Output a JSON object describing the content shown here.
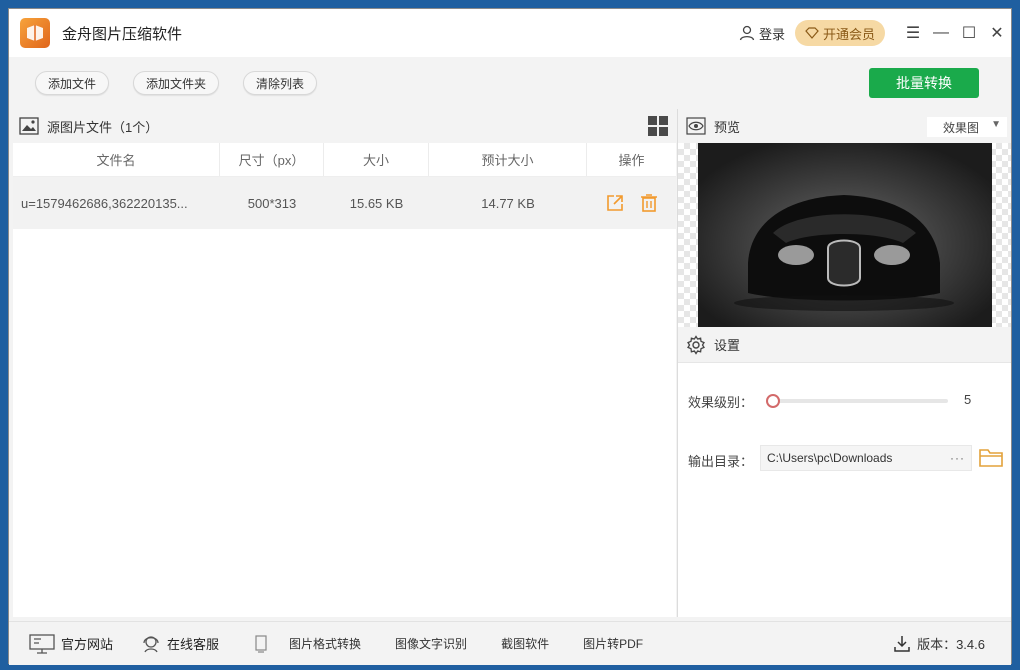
{
  "app": {
    "title": "金舟图片压缩软件"
  },
  "titlebar": {
    "login_label": "登录",
    "vip_label": "开通会员"
  },
  "toolbar": {
    "add_file_label": "添加文件",
    "add_folder_label": "添加文件夹",
    "clear_list_label": "清除列表",
    "batch_convert_label": "批量转换"
  },
  "source": {
    "header_label": "源图片文件（1个）",
    "columns": [
      "文件名",
      "尺寸（px）",
      "大小",
      "预计大小",
      "操作"
    ],
    "rows": [
      {
        "filename": "u=1579462686,362220135...",
        "dimensions": "500*313",
        "size": "15.65 KB",
        "estimated_size": "14.77 KB"
      }
    ]
  },
  "preview": {
    "label": "预览",
    "mode_selected": "效果图"
  },
  "settings": {
    "label": "设置",
    "effect_level_label": "效果级别：",
    "effect_level_value": "5",
    "output_dir_label": "输出目录：",
    "output_dir_value": "C:\\Users\\pc\\Downloads",
    "browse_label": "···"
  },
  "footer": {
    "official_site_label": "官方网站",
    "online_service_label": "在线客服",
    "links": [
      "图片格式转换",
      "图像文字识别",
      "截图软件",
      "图片转PDF"
    ],
    "version_label": "版本：3.4.6"
  },
  "colors": {
    "accent_green": "#1aaa4b",
    "vip_gold": "#f6d9a4",
    "logo_orange": "#e0651b",
    "delete_orange": "#f29a2e"
  }
}
